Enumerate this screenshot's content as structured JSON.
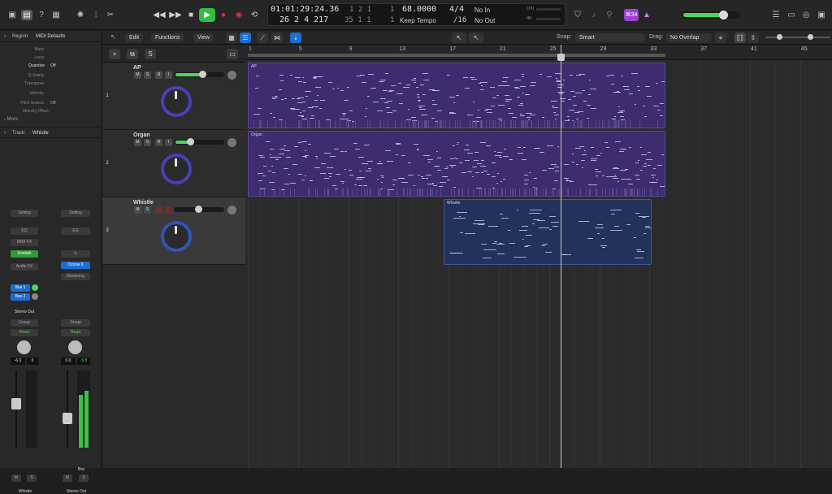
{
  "colors": {
    "accent": "#1e6dd0",
    "green": "#4fd45a",
    "record": "#e0333f",
    "play": "#2fbf42",
    "purple": "#9b3fd0",
    "region_purple": "#3d2c6e",
    "region_blue": "#22325a"
  },
  "lcd": {
    "time": "01:01:29:24.36",
    "bars": "26  2  4  217",
    "ss1": "1  2  1",
    "ss1b": "1",
    "ss2": "35  1  1",
    "ss2b": "1",
    "tempo": "68.0000",
    "tempo_label": "Keep Tempo",
    "sig": "4/4",
    "sig2": "/16",
    "in": "No In",
    "out": "No Out",
    "cpu": "CPU",
    "hd": "HD"
  },
  "badge": "⌘34",
  "subbar": {
    "edit": "Edit",
    "functions": "Functions",
    "view": "View",
    "snap_label": "Snap:",
    "snap_value": "Smart",
    "drag_label": "Drag:",
    "drag_value": "No Overlap"
  },
  "inspector": {
    "region_title": "Region:",
    "region_name": "MIDI Defaults",
    "rows": [
      {
        "l": "Mute:",
        "v": ""
      },
      {
        "l": "Loop:",
        "v": ""
      },
      {
        "l": "Quantize",
        "v": "Off"
      },
      {
        "l": "Q-Swing:",
        "v": ""
      },
      {
        "l": "Transpose:",
        "v": ""
      },
      {
        "l": "Velocity:",
        "v": ""
      },
      {
        "l": "",
        "v": ""
      },
      {
        "l": "Pitch Source:",
        "v": "Off"
      },
      {
        "l": "Velocity Offset:",
        "v": ""
      }
    ],
    "more": "More",
    "track_title": "Track:",
    "track_name": "Whistle"
  },
  "strip1": {
    "setting": "Setting",
    "eq": "EQ",
    "midifx": "MIDI FX",
    "instrument": "Kontakt",
    "audiofx": "Audio FX",
    "bus1": "Bus 1",
    "bus2": "Bus 2",
    "output": "Stereo Out",
    "group": "Group",
    "read": "Read",
    "vol": "-6.0",
    "vol2": "0",
    "m": "M",
    "s": "S",
    "name": "Whistle"
  },
  "strip2": {
    "setting": "Setting",
    "eq": "EQ",
    "plugin": "Ozone 9",
    "audiofx": "Mastering",
    "group": "Group",
    "read": "Read",
    "vol": "0.0",
    "peak": "-5.8",
    "bnc": "Bnc",
    "m": "M",
    "s": "S",
    "name": "Stereo Out"
  },
  "tracks": [
    {
      "num": "1",
      "name": "AP",
      "m": "M",
      "s": "S",
      "r": "R",
      "i": "I",
      "vol": 0.6
    },
    {
      "num": "2",
      "name": "Organ",
      "m": "M",
      "s": "S",
      "r": "R",
      "i": "I",
      "vol": 0.3
    },
    {
      "num": "3",
      "name": "Whistle",
      "m": "M",
      "s": "S",
      "r": "",
      "i": "",
      "vol": 0.5
    }
  ],
  "ruler": [
    "1",
    "5",
    "9",
    "13",
    "17",
    "21",
    "25",
    "29",
    "33",
    "37",
    "41",
    "45"
  ],
  "regions": [
    {
      "name": "AP"
    },
    {
      "name": "Organ"
    },
    {
      "name": "Whistle"
    }
  ]
}
